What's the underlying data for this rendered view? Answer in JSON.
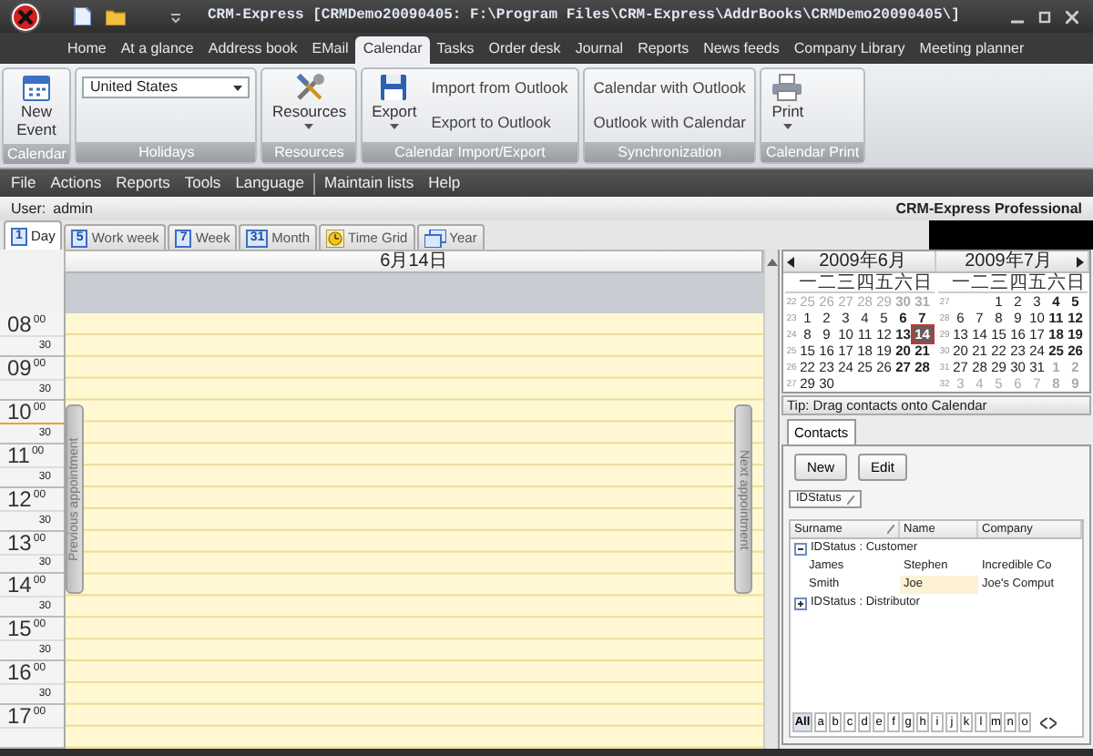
{
  "window": {
    "title": "CRM-Express [CRMDemo20090405: F:\\Program Files\\CRM-Express\\AddrBooks\\CRMDemo20090405\\]"
  },
  "tabs": [
    {
      "label": "Home",
      "selected": false
    },
    {
      "label": "At a glance",
      "selected": false
    },
    {
      "label": "Address book",
      "selected": false
    },
    {
      "label": "EMail",
      "selected": false
    },
    {
      "label": "Calendar",
      "selected": true
    },
    {
      "label": "Tasks",
      "selected": false
    },
    {
      "label": "Order desk",
      "selected": false
    },
    {
      "label": "Journal",
      "selected": false
    },
    {
      "label": "Reports",
      "selected": false
    },
    {
      "label": "News feeds",
      "selected": false
    },
    {
      "label": "Company Library",
      "selected": false
    },
    {
      "label": "Meeting planner",
      "selected": false
    }
  ],
  "ribbon": {
    "groups": [
      {
        "label": "Calendar",
        "items": [
          {
            "kind": "event",
            "label": "New Event"
          }
        ]
      },
      {
        "label": "Holidays",
        "items": [
          {
            "kind": "select",
            "label": "United States"
          }
        ]
      },
      {
        "label": "Resources",
        "items": [
          {
            "kind": "tools",
            "label": "Resources"
          }
        ]
      },
      {
        "label": "Calendar Import/Export",
        "items": [
          {
            "kind": "disk",
            "label": "Export"
          },
          {
            "kind": "link",
            "label": "Import from Outlook"
          },
          {
            "kind": "link",
            "label": "Export to Outlook"
          }
        ]
      },
      {
        "label": "Synchronization",
        "items": [
          {
            "kind": "link",
            "label": "Calendar with Outlook"
          },
          {
            "kind": "link",
            "label": "Outlook with Calendar"
          }
        ]
      },
      {
        "label": "Calendar Print",
        "items": [
          {
            "kind": "printer",
            "label": "Print"
          }
        ]
      }
    ]
  },
  "menu": [
    {
      "kind": "item",
      "label": "File"
    },
    {
      "kind": "item",
      "label": "Actions"
    },
    {
      "kind": "item",
      "label": "Reports"
    },
    {
      "kind": "item",
      "label": "Tools"
    },
    {
      "kind": "item",
      "label": "Language"
    },
    {
      "kind": "separator"
    },
    {
      "kind": "item",
      "label": "Maintain lists"
    },
    {
      "kind": "item",
      "label": "Help"
    }
  ],
  "user": {
    "label": "User:",
    "value": "admin"
  },
  "brand": "CRM-Express Professional",
  "view_tabs": [
    {
      "kind": "number",
      "icon_text": "1",
      "label": "Day",
      "selected": true
    },
    {
      "kind": "number",
      "icon_text": "5",
      "label": "Work week",
      "selected": false
    },
    {
      "kind": "number",
      "icon_text": "7",
      "label": "Week",
      "selected": false
    },
    {
      "kind": "number",
      "icon_text": "31",
      "label": "Month",
      "selected": false
    },
    {
      "kind": "clock",
      "label": "Time Grid",
      "selected": false
    },
    {
      "kind": "year",
      "label": "Year",
      "selected": false
    }
  ],
  "day_view": {
    "date": "6月14日",
    "previous": "Previous appointment",
    "next": "Next appointment",
    "hours": [
      {
        "hour": "08",
        "minutes": "00",
        "half": "30",
        "current": false
      },
      {
        "hour": "09",
        "minutes": "00",
        "half": "30",
        "current": false
      },
      {
        "hour": "10",
        "minutes": "00",
        "half": "30",
        "current": true
      },
      {
        "hour": "11",
        "minutes": "00",
        "half": "30",
        "current": false
      },
      {
        "hour": "12",
        "minutes": "00",
        "half": "30",
        "current": false
      },
      {
        "hour": "13",
        "minutes": "00",
        "half": "30",
        "current": false
      },
      {
        "hour": "14",
        "minutes": "00",
        "half": "30",
        "current": false
      },
      {
        "hour": "15",
        "minutes": "00",
        "half": "30",
        "current": false
      },
      {
        "hour": "16",
        "minutes": "00",
        "half": "30",
        "current": false
      },
      {
        "hour": "17",
        "minutes": "00",
        "current": false
      }
    ]
  },
  "mini_calendar": {
    "months": [
      {
        "title": "2009年6月",
        "weekdays": [
          "一",
          "二",
          "三",
          "四",
          "五",
          "六",
          "日"
        ],
        "weeks": [
          {
            "week": "22",
            "days": [
              {
                "n": "25",
                "muted": true,
                "selected": false
              },
              {
                "n": "26",
                "muted": true,
                "selected": false
              },
              {
                "n": "27",
                "muted": true,
                "selected": false
              },
              {
                "n": "28",
                "muted": true,
                "selected": false
              },
              {
                "n": "29",
                "muted": true,
                "selected": false
              },
              {
                "n": "30",
                "muted": true,
                "selected": false
              },
              {
                "n": "31",
                "muted": true,
                "selected": false
              }
            ]
          },
          {
            "week": "23",
            "days": [
              {
                "n": "1",
                "muted": false,
                "selected": false
              },
              {
                "n": "2",
                "muted": false,
                "selected": false
              },
              {
                "n": "3",
                "muted": false,
                "selected": false
              },
              {
                "n": "4",
                "muted": false,
                "selected": false
              },
              {
                "n": "5",
                "muted": false,
                "selected": false
              },
              {
                "n": "6",
                "muted": false,
                "selected": false
              },
              {
                "n": "7",
                "muted": false,
                "selected": false
              }
            ]
          },
          {
            "week": "24",
            "days": [
              {
                "n": "8",
                "muted": false,
                "selected": false
              },
              {
                "n": "9",
                "muted": false,
                "selected": false
              },
              {
                "n": "10",
                "muted": false,
                "selected": false
              },
              {
                "n": "11",
                "muted": false,
                "selected": false
              },
              {
                "n": "12",
                "muted": false,
                "selected": false
              },
              {
                "n": "13",
                "muted": false,
                "selected": false
              },
              {
                "n": "14",
                "muted": false,
                "selected": true
              }
            ]
          },
          {
            "week": "25",
            "days": [
              {
                "n": "15",
                "muted": false,
                "selected": false
              },
              {
                "n": "16",
                "muted": false,
                "selected": false
              },
              {
                "n": "17",
                "muted": false,
                "selected": false
              },
              {
                "n": "18",
                "muted": false,
                "selected": false
              },
              {
                "n": "19",
                "muted": false,
                "selected": false
              },
              {
                "n": "20",
                "muted": false,
                "selected": false
              },
              {
                "n": "21",
                "muted": false,
                "selected": false
              }
            ]
          },
          {
            "week": "26",
            "days": [
              {
                "n": "22",
                "muted": false,
                "selected": false
              },
              {
                "n": "23",
                "muted": false,
                "selected": false
              },
              {
                "n": "24",
                "muted": false,
                "selected": false
              },
              {
                "n": "25",
                "muted": false,
                "selected": false
              },
              {
                "n": "26",
                "muted": false,
                "selected": false
              },
              {
                "n": "27",
                "muted": false,
                "selected": false
              },
              {
                "n": "28",
                "muted": false,
                "selected": false
              }
            ]
          },
          {
            "week": "27",
            "days": [
              {
                "n": "29",
                "muted": false,
                "selected": false
              },
              {
                "n": "30",
                "muted": false,
                "selected": false
              }
            ]
          }
        ]
      },
      {
        "title": "2009年7月",
        "weekdays": [
          "一",
          "二",
          "三",
          "四",
          "五",
          "六",
          "日"
        ],
        "weeks": [
          {
            "week": "27",
            "days": [
              {
                "n": "1",
                "muted": false,
                "selected": false
              },
              {
                "n": "2",
                "muted": false,
                "selected": false
              },
              {
                "n": "3",
                "muted": false,
                "selected": false
              },
              {
                "n": "4",
                "muted": false,
                "selected": false
              },
              {
                "n": "5",
                "muted": false,
                "selected": false
              }
            ]
          },
          {
            "week": "28",
            "days": [
              {
                "n": "6",
                "muted": false,
                "selected": false
              },
              {
                "n": "7",
                "muted": false,
                "selected": false
              },
              {
                "n": "8",
                "muted": false,
                "selected": false
              },
              {
                "n": "9",
                "muted": false,
                "selected": false
              },
              {
                "n": "10",
                "muted": false,
                "selected": false
              },
              {
                "n": "11",
                "muted": false,
                "selected": false
              },
              {
                "n": "12",
                "muted": false,
                "selected": false
              }
            ]
          },
          {
            "week": "29",
            "days": [
              {
                "n": "13",
                "muted": false,
                "selected": false
              },
              {
                "n": "14",
                "muted": false,
                "selected": false
              },
              {
                "n": "15",
                "muted": false,
                "selected": false
              },
              {
                "n": "16",
                "muted": false,
                "selected": false
              },
              {
                "n": "17",
                "muted": false,
                "selected": false
              },
              {
                "n": "18",
                "muted": false,
                "selected": false
              },
              {
                "n": "19",
                "muted": false,
                "selected": false
              }
            ]
          },
          {
            "week": "30",
            "days": [
              {
                "n": "20",
                "muted": false,
                "selected": false
              },
              {
                "n": "21",
                "muted": false,
                "selected": false
              },
              {
                "n": "22",
                "muted": false,
                "selected": false
              },
              {
                "n": "23",
                "muted": false,
                "selected": false
              },
              {
                "n": "24",
                "muted": false,
                "selected": false
              },
              {
                "n": "25",
                "muted": false,
                "selected": false
              },
              {
                "n": "26",
                "muted": false,
                "selected": false
              }
            ]
          },
          {
            "week": "31",
            "days": [
              {
                "n": "27",
                "muted": false,
                "selected": false
              },
              {
                "n": "28",
                "muted": false,
                "selected": false
              },
              {
                "n": "29",
                "muted": false,
                "selected": false
              },
              {
                "n": "30",
                "muted": false,
                "selected": false
              },
              {
                "n": "31",
                "muted": false,
                "selected": false
              },
              {
                "n": "1",
                "muted": true,
                "selected": false
              },
              {
                "n": "2",
                "muted": true,
                "selected": false
              }
            ]
          },
          {
            "week": "32",
            "days": [
              {
                "n": "3",
                "muted": true,
                "selected": false
              },
              {
                "n": "4",
                "muted": true,
                "selected": false
              },
              {
                "n": "5",
                "muted": true,
                "selected": false
              },
              {
                "n": "6",
                "muted": true,
                "selected": false
              },
              {
                "n": "7",
                "muted": true,
                "selected": false
              },
              {
                "n": "8",
                "muted": true,
                "selected": false
              },
              {
                "n": "9",
                "muted": true,
                "selected": false
              }
            ]
          }
        ]
      }
    ]
  },
  "contacts": {
    "tip": "Tip: Drag contacts onto Calendar",
    "tabs": [
      {
        "label": "Contacts",
        "selected": true
      }
    ],
    "buttons": [
      "New",
      "Edit"
    ],
    "group_by": "IDStatus",
    "columns": [
      "Surname",
      "Name",
      "Company"
    ],
    "groups": [
      {
        "label": "IDStatus : Customer",
        "expanded": true,
        "rows": [
          {
            "cells": [
              "James",
              "Stephen",
              "Incredible Co"
            ],
            "selected": false
          },
          {
            "cells": [
              "Smith",
              "Joe",
              "Joe's Comput"
            ],
            "selected": true
          }
        ]
      },
      {
        "label": "IDStatus : Distributor",
        "expanded": false
      }
    ],
    "alphabet": [
      {
        "label": "All",
        "selected": true
      },
      {
        "label": "a",
        "selected": false
      },
      {
        "label": "b",
        "selected": false
      },
      {
        "label": "c",
        "selected": false
      },
      {
        "label": "d",
        "selected": false
      },
      {
        "label": "e",
        "selected": false
      },
      {
        "label": "f",
        "selected": false
      },
      {
        "label": "g",
        "selected": false
      },
      {
        "label": "h",
        "selected": false
      },
      {
        "label": "i",
        "selected": false
      },
      {
        "label": "j",
        "selected": false
      },
      {
        "label": "k",
        "selected": false
      },
      {
        "label": "l",
        "selected": false
      },
      {
        "label": "m",
        "selected": false
      },
      {
        "label": "n",
        "selected": false
      },
      {
        "label": "o",
        "selected": false
      }
    ]
  }
}
